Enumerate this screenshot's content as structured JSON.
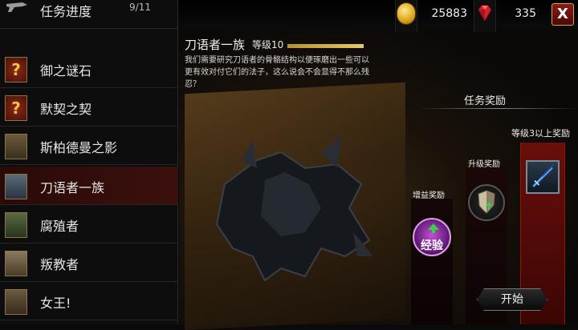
{
  "resources": {
    "gold": "25883",
    "gems": "335"
  },
  "close_label": "X",
  "sidebar": {
    "items": [
      {
        "label": "任务进度",
        "count": "9/11",
        "icon": "quest-progress-icon"
      },
      {
        "label": "御之谜石",
        "icon": "question-mark-icon"
      },
      {
        "label": "默契之契",
        "icon": "question-mark-icon"
      },
      {
        "label": "斯柏德曼之影",
        "icon": "portrait-icon"
      },
      {
        "label": "刀语者一族",
        "icon": "portrait-icon",
        "active": true
      },
      {
        "label": "腐殖者",
        "icon": "portrait-icon"
      },
      {
        "label": "叛教者",
        "icon": "portrait-icon"
      },
      {
        "label": "女王!",
        "icon": "portrait-icon"
      }
    ]
  },
  "quest": {
    "title": "刀语者一族",
    "level": "等级10",
    "description": "我们需要研究刀语者的骨骼结构以便琢磨出一些可以更有效对付它们的法子，这么说会不会显得不那么残忍？"
  },
  "rewards": {
    "header": "任务奖励",
    "level3_label": "等级3以上奖励",
    "upgrade_label": "升级奖励",
    "bonus_label": "增益奖励",
    "xp_label": "经验"
  },
  "start_label": "开始",
  "colors": {
    "accent_gold": "#e6c86a",
    "active_row": "#3a100d",
    "reward_red": "#6a0f0a",
    "xp_purple": "#c050d0"
  }
}
